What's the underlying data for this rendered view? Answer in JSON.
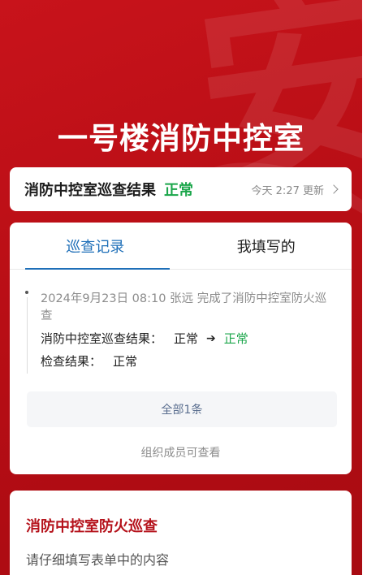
{
  "hero": {
    "watermark": "安",
    "title": "一号楼消防中控室"
  },
  "status": {
    "label": "消防中控室巡查结果",
    "value": "正常",
    "meta": "今天 2:27 更新"
  },
  "tabs": [
    {
      "label": "巡查记录",
      "active": true
    },
    {
      "label": "我填写的",
      "active": false
    }
  ],
  "record": {
    "header": "2024年9月23日 08:10  张远  完成了消防中控室防火巡查",
    "change_label": "消防中控室巡查结果：",
    "change_from": "正常",
    "change_to": "正常",
    "check_label": "检查结果：",
    "check_value": "正常"
  },
  "all_button": "全部1条",
  "visibility_note": "组织成员可查看",
  "form": {
    "title": "消防中控室防火巡查",
    "subtitle": "请仔细填写表单中的内容"
  },
  "colors": {
    "brand_red": "#c8131b",
    "ok_green": "#1aa64a",
    "tab_blue": "#1e6fb8"
  }
}
